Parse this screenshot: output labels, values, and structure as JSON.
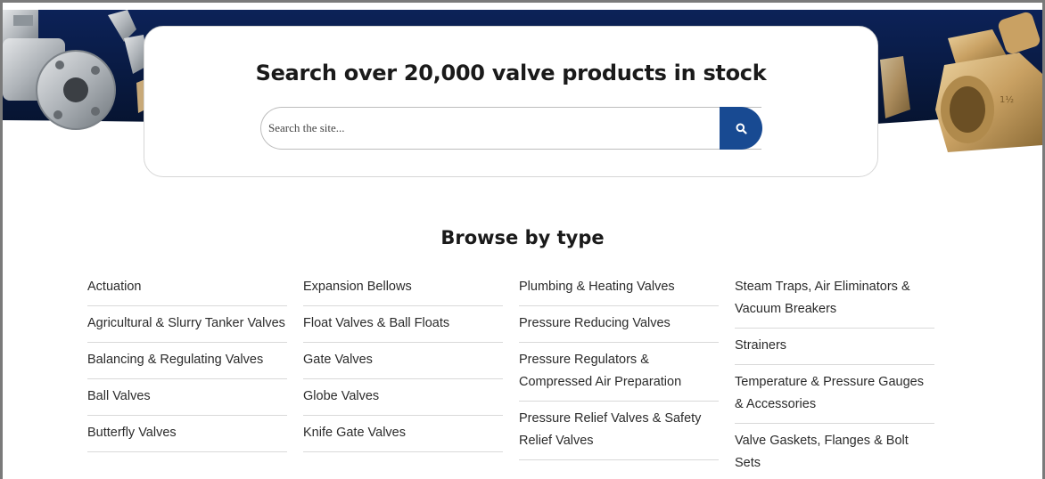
{
  "search": {
    "title": "Search over 20,000 valve products in stock",
    "placeholder": "Search the site...",
    "button_icon": "search-icon"
  },
  "browse": {
    "title": "Browse by type",
    "columns": [
      [
        "Actuation",
        "Agricultural & Slurry Tanker Valves",
        "Balancing & Regulating Valves",
        "Ball Valves",
        "Butterfly Valves"
      ],
      [
        "Expansion Bellows",
        "Float Valves & Ball Floats",
        "Gate Valves",
        "Globe Valves",
        "Knife Gate Valves"
      ],
      [
        "Plumbing & Heating Valves",
        "Pressure Reducing Valves",
        "Pressure Regulators & Compressed Air Preparation",
        "Pressure Relief Valves & Safety Relief Valves"
      ],
      [
        "Steam Traps, Air Eliminators & Vacuum Breakers",
        "Strainers",
        "Temperature & Pressure Gauges & Accessories",
        "Valve Gaskets, Flanges & Bolt Sets"
      ]
    ]
  },
  "colors": {
    "banner_navy": "#0a1f4a",
    "button_blue": "#184a92"
  }
}
